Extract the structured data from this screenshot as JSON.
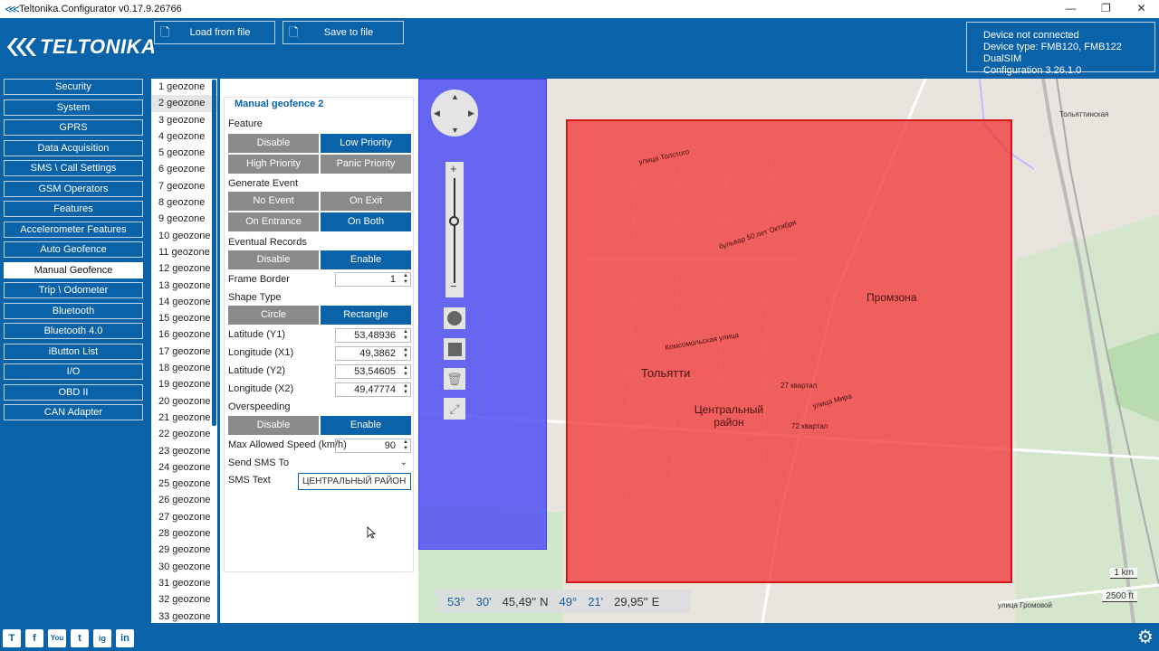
{
  "window": {
    "title": "Teltonika.Configurator v0.17.9.26766",
    "controls": [
      "—",
      "❐",
      "✕"
    ]
  },
  "header": {
    "logo_text": "TELTONIKA",
    "load_button": "Load from file",
    "save_button": "Save to file",
    "device": {
      "status": "Device not connected",
      "type": "Device type: FMB120, FMB122 DualSIM",
      "configuration": "Configuration 3.26.1.0"
    }
  },
  "nav": {
    "items": [
      "Security",
      "System",
      "GPRS",
      "Data Acquisition",
      "SMS \\ Call Settings",
      "GSM Operators",
      "Features",
      "Accelerometer Features",
      "Auto Geofence",
      "Manual Geofence",
      "Trip \\ Odometer",
      "Bluetooth",
      "Bluetooth 4.0",
      "iButton List",
      "I/O",
      "OBD II",
      "CAN Adapter"
    ],
    "active": "Manual Geofence"
  },
  "geozones": {
    "items": [
      "1 geozone",
      "2 geozone",
      "3 geozone",
      "4 geozone",
      "5 geozone",
      "6 geozone",
      "7 geozone",
      "8 geozone",
      "9 geozone",
      "10 geozone",
      "11 geozone",
      "12 geozone",
      "13 geozone",
      "14 geozone",
      "15 geozone",
      "16 geozone",
      "17 geozone",
      "18 geozone",
      "19 geozone",
      "20 geozone",
      "21 geozone",
      "22 geozone",
      "23 geozone",
      "24 geozone",
      "25 geozone",
      "26 geozone",
      "27 geozone",
      "28 geozone",
      "29 geozone",
      "30 geozone",
      "31 geozone",
      "32 geozone",
      "33 geozone"
    ],
    "selected": "2 geozone"
  },
  "panel": {
    "title": "Manual geofence 2",
    "feature": {
      "label": "Feature",
      "options": [
        "Disable",
        "Low Priority",
        "High Priority",
        "Panic Priority"
      ],
      "selected": "Low Priority"
    },
    "generate_event": {
      "label": "Generate Event",
      "options": [
        "No Event",
        "On Exit",
        "On Entrance",
        "On Both"
      ],
      "selected": "On Both"
    },
    "eventual_records": {
      "label": "Eventual Records",
      "options": [
        "Disable",
        "Enable"
      ],
      "selected": "Enable"
    },
    "frame_border": {
      "label": "Frame Border",
      "value": "1"
    },
    "shape_type": {
      "label": "Shape Type",
      "options": [
        "Circle",
        "Rectangle"
      ],
      "selected": "Rectangle"
    },
    "lat_y1": {
      "label": "Latitude (Y1)",
      "value": "53,48936"
    },
    "lon_x1": {
      "label": "Longitude (X1)",
      "value": "49,3862"
    },
    "lat_y2": {
      "label": "Latitude (Y2)",
      "value": "53,54605"
    },
    "lon_x2": {
      "label": "Longitude (X2)",
      "value": "49,47774"
    },
    "overspeeding": {
      "label": "Overspeeding",
      "options": [
        "Disable",
        "Enable"
      ],
      "selected": "Enable"
    },
    "max_speed": {
      "label": "Max Allowed Speed (km/h)",
      "value": "90"
    },
    "send_sms_to": {
      "label": "Send SMS To",
      "value": ""
    },
    "sms_text": {
      "label": "SMS Text",
      "value": "ЦЕНТРАЛЬНЫЙ РАЙОН"
    }
  },
  "map": {
    "labels": {
      "city": "Тольятти",
      "district": "Центральный район",
      "promzona": "Промзона",
      "street1": "улица Толстого",
      "street2": "бульвар 50 лет Октября",
      "street3": "Комсомольская улица",
      "street4": "улица Мира",
      "street5": "27 квартал",
      "street6": "72 квартал",
      "street7": "улица Громовой",
      "street8": "Тольяттинская"
    },
    "coords": {
      "lat_deg": "53°",
      "lat_min": "30'",
      "lat_sec": "45,49''",
      "lat_hem": "N",
      "lon_deg": "49°",
      "lon_min": "21'",
      "lon_sec": "29,95''",
      "lon_hem": "E"
    },
    "scale_km": "1 km",
    "scale_ft": "2500 ft",
    "colors": {
      "blue_zone": "#5050f5",
      "red_zone": "#f03232"
    }
  },
  "footer": {
    "social": [
      "T",
      "f",
      "You",
      "t",
      "ig",
      "in"
    ]
  }
}
